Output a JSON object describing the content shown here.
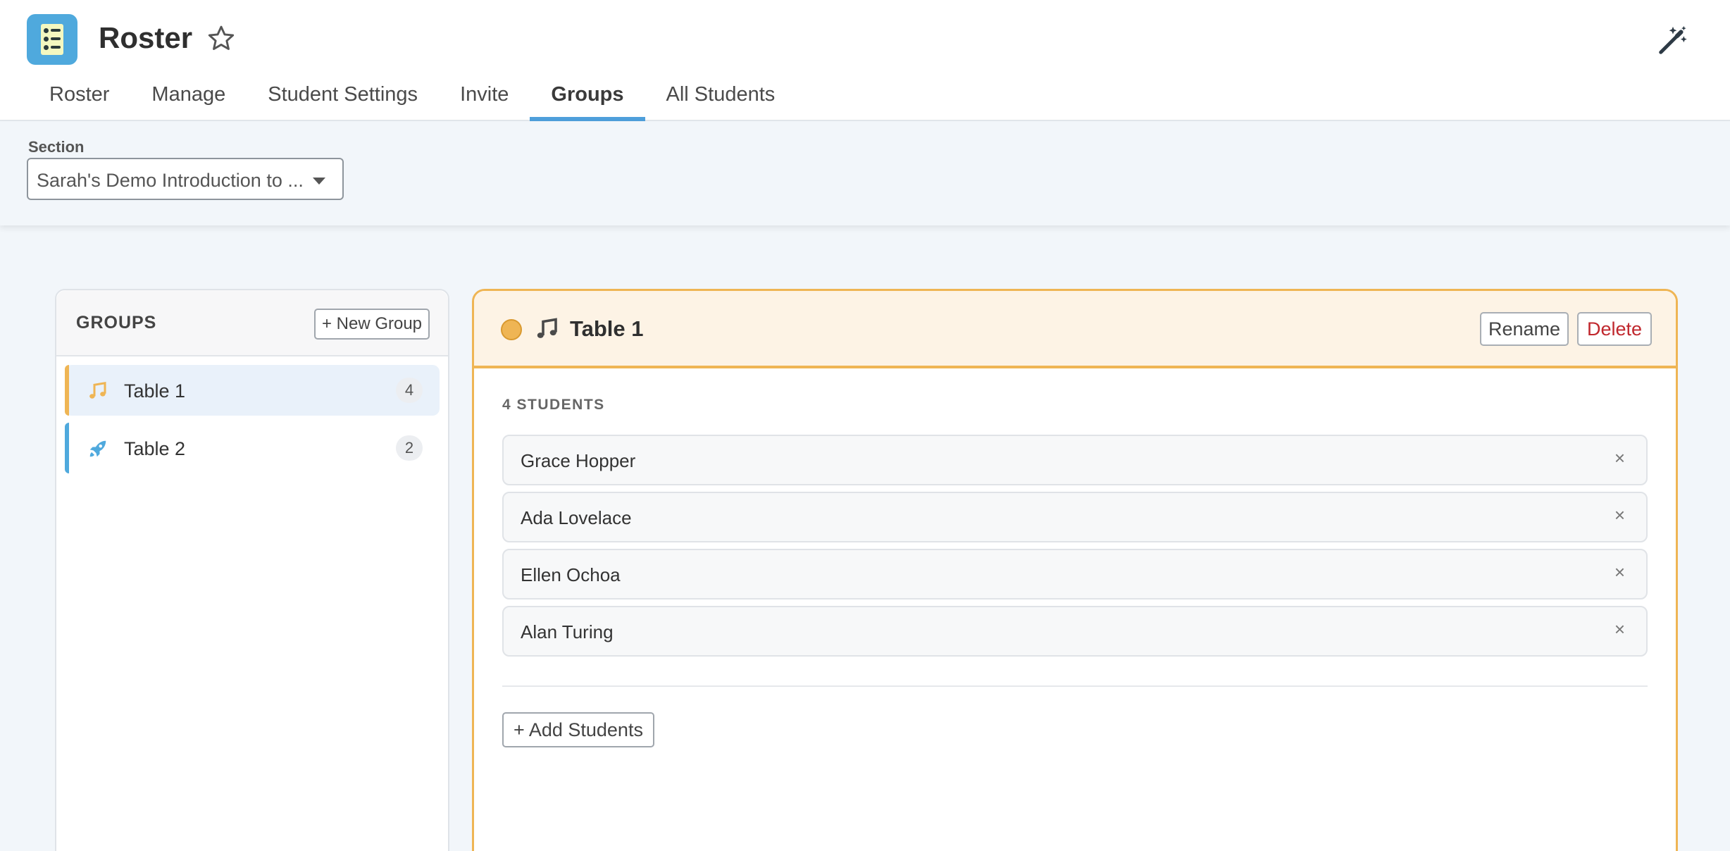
{
  "app": {
    "title": "Roster",
    "icon": "roster-app-icon",
    "accent_color": "#4e9fdb"
  },
  "tabs": [
    {
      "label": "Roster"
    },
    {
      "label": "Manage"
    },
    {
      "label": "Student Settings"
    },
    {
      "label": "Invite"
    },
    {
      "label": "Groups",
      "active": true
    },
    {
      "label": "All Students"
    }
  ],
  "section": {
    "label": "Section",
    "selected_value": "Sarah's Demo Introduction to ..."
  },
  "groups": {
    "title": "GROUPS",
    "new_group_label": "+ New Group",
    "items": [
      {
        "name": "Table 1",
        "count": "4",
        "icon": "music-note-icon",
        "color": "#efb554",
        "selected": true
      },
      {
        "name": "Table 2",
        "count": "2",
        "icon": "rocket-icon",
        "color": "#4fa9dd",
        "selected": false
      }
    ]
  },
  "detail": {
    "title": "Table 1",
    "icon": "music-note-icon",
    "color": "#efb554",
    "rename_label": "Rename",
    "delete_label": "Delete",
    "students_count_label": "4 STUDENTS",
    "students": [
      {
        "name": "Grace Hopper"
      },
      {
        "name": "Ada Lovelace"
      },
      {
        "name": "Ellen Ochoa"
      },
      {
        "name": "Alan Turing"
      }
    ],
    "remove_glyph": "×",
    "add_students_label": "+ Add Students"
  }
}
